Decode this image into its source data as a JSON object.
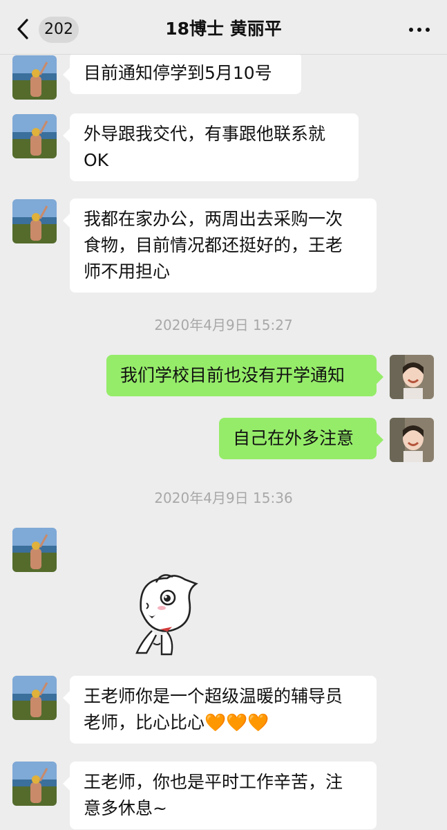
{
  "header": {
    "back_count": "202",
    "title": "18博士 黄丽平"
  },
  "messages": [
    {
      "side": "left",
      "text": "目前通知停学到5月10号"
    },
    {
      "side": "left",
      "text": "外导跟我交代，有事跟他联系就\nOK"
    },
    {
      "side": "left",
      "text": "我都在家办公，两周出去采购一次\n食物，目前情况都还挺好的，王老\n师不用担心"
    },
    {
      "type": "timestamp",
      "text": "2020年4月9日 15:27"
    },
    {
      "side": "right",
      "text": "我们学校目前也没有开学通知"
    },
    {
      "side": "right",
      "text": "自己在外多注意"
    },
    {
      "type": "timestamp",
      "text": "2020年4月9日 15:36"
    },
    {
      "side": "left",
      "type": "sticker",
      "sticker": "white-kitten-sticker"
    },
    {
      "side": "left",
      "text": "王老师你是一个超级温暖的辅导员\n老师，比心比心🧡🧡🧡"
    },
    {
      "side": "left",
      "text": "王老师，你也是平时工作辛苦，注\n意多休息~"
    }
  ],
  "icons": {
    "back": "chevron-left-icon",
    "more": "more-dots-icon"
  },
  "colors": {
    "background": "#ededed",
    "outgoing_bubble": "#95ec69",
    "incoming_bubble": "#ffffff",
    "timestamp": "#a8a8a8"
  }
}
